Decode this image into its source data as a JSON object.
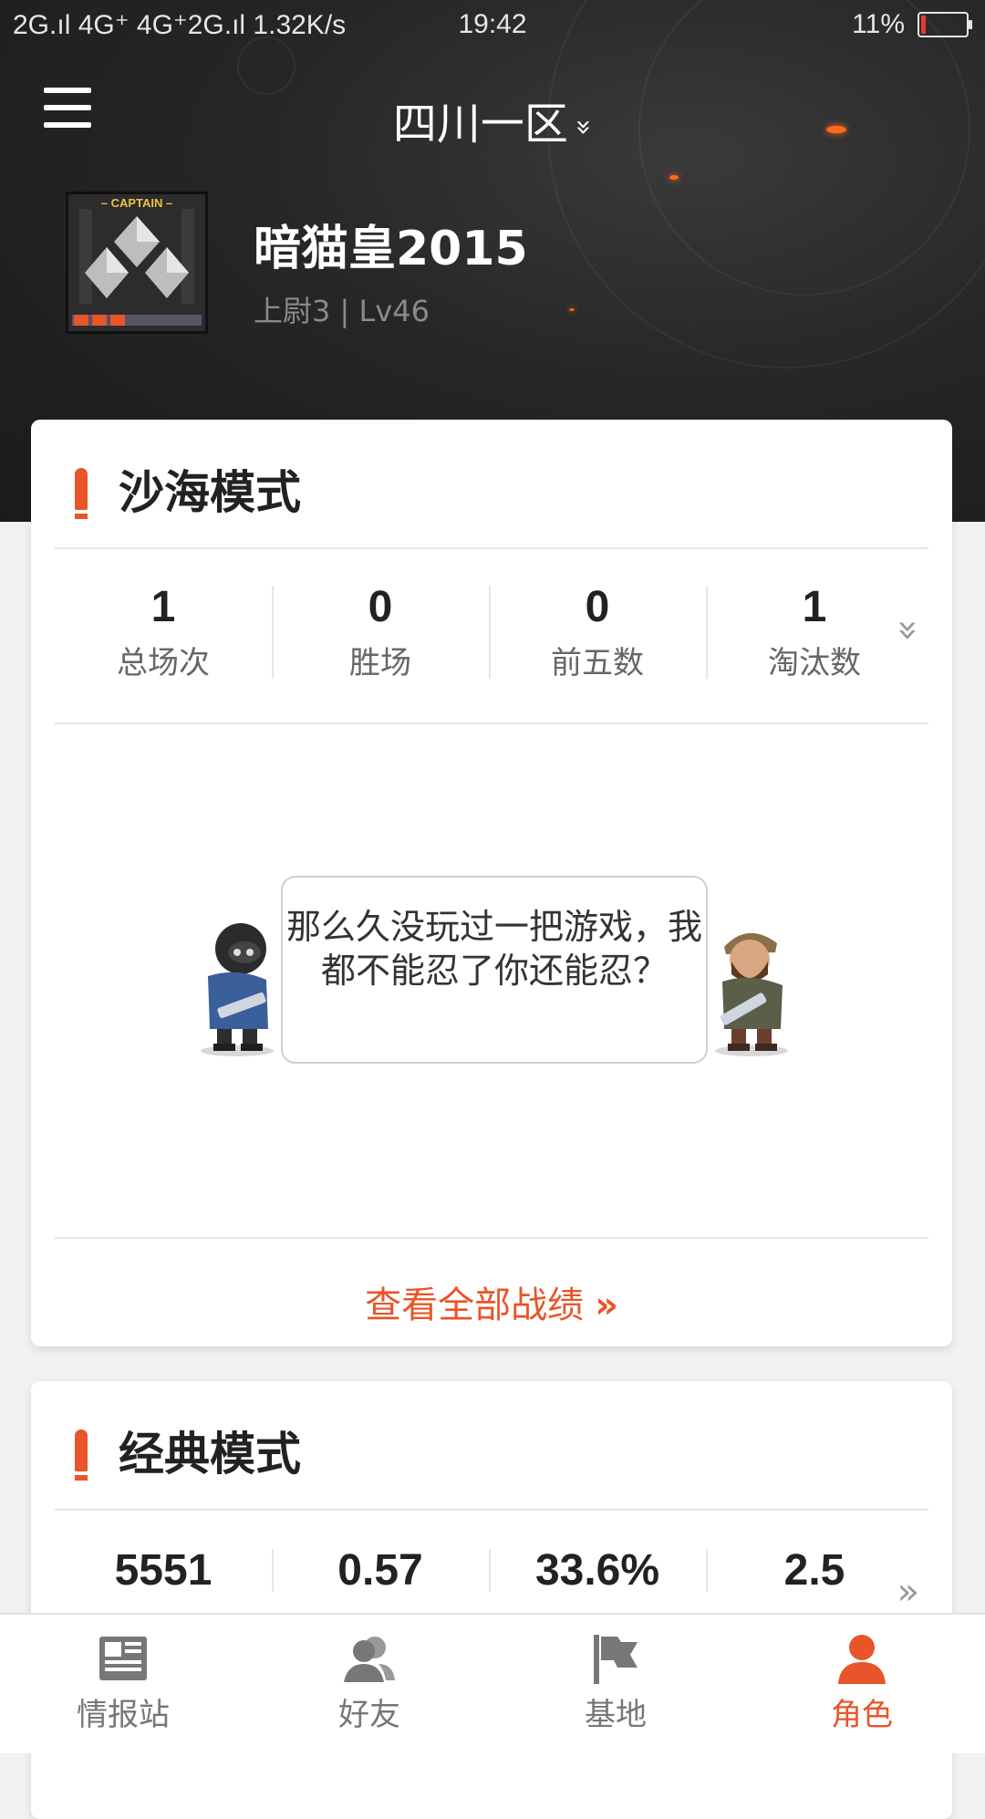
{
  "status_bar": {
    "network": "2G.ıl 4G⁺ 4G⁺2G.ıl 1.32K/s",
    "time": "19:42",
    "battery": "11%",
    "battery_level": 0.11
  },
  "header": {
    "server": "四川一区",
    "server_chevron": "»"
  },
  "profile": {
    "badge_text": "– CAPTAIN –",
    "username": "暗猫皇2015",
    "rank_level": "上尉3 | Lv46"
  },
  "sand_mode": {
    "title": "沙海模式",
    "stats": [
      {
        "value": "1",
        "label": "总场次"
      },
      {
        "value": "0",
        "label": "胜场"
      },
      {
        "value": "0",
        "label": "前五数"
      },
      {
        "value": "1",
        "label": "淘汰数"
      }
    ],
    "expand_icon": "»",
    "empty_message": "那么久没玩过一把游戏，我都不能忍了你还能忍？",
    "view_all": "查看全部战绩",
    "view_all_arrows": "»"
  },
  "classic_mode": {
    "title": "经典模式",
    "stats": [
      {
        "value": "5551"
      },
      {
        "value": "0.57"
      },
      {
        "value": "33.6%"
      },
      {
        "value": "2.5"
      }
    ],
    "more_icon": "»"
  },
  "tabs": [
    {
      "label": "情报站",
      "icon": "news-icon"
    },
    {
      "label": "好友",
      "icon": "friends-icon"
    },
    {
      "label": "基地",
      "icon": "flag-icon"
    },
    {
      "label": "角色",
      "icon": "person-icon",
      "active": true
    }
  ],
  "colors": {
    "accent": "#e8552a",
    "header_bg": "#262626"
  }
}
